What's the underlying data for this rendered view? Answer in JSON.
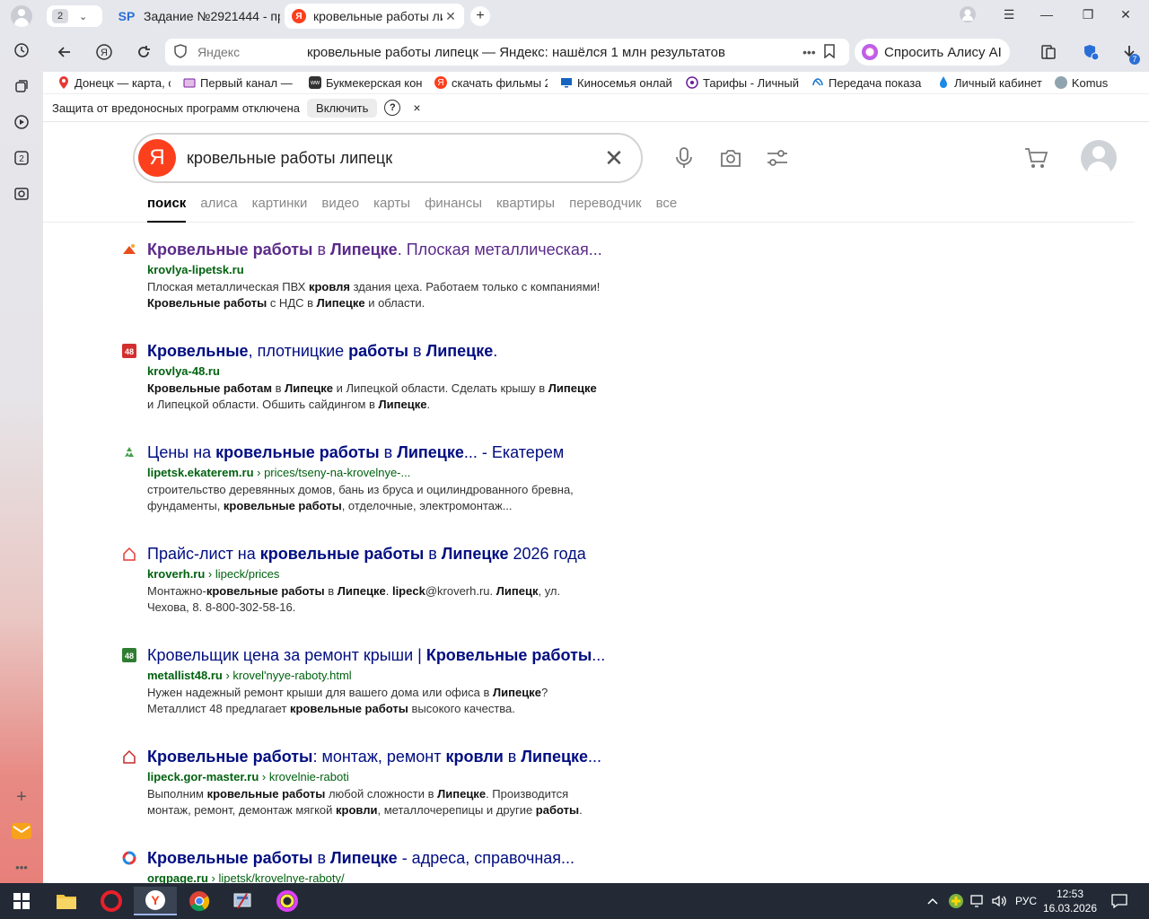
{
  "browser": {
    "tab_count": "2",
    "tabs": [
      {
        "title": "Задание №2921444 - про",
        "favicon": "SP"
      },
      {
        "title": "кровельные работы ли",
        "favicon": "Я"
      }
    ],
    "new_tab_symbol": "+",
    "address": {
      "host": "Яндекс",
      "page_title": "кровельные работы липецк — Яндекс: нашёлся 1 млн результатов"
    },
    "alice_button": "Спросить Алису AI",
    "downloads_badge": "7",
    "bookmarks": [
      {
        "label": "Донецк — карта, с",
        "icon": "map-pin-icon",
        "color": "#e53935"
      },
      {
        "label": "Первый канал — с",
        "icon": "tv-icon",
        "color": "#7b1fa2"
      },
      {
        "label": "Букмекерская кон",
        "icon": "betting-icon",
        "color": "#333333"
      },
      {
        "label": "скачать фильмы 2",
        "icon": "yandex-icon",
        "color": "#fc3f1d"
      },
      {
        "label": "Киносемья онлай",
        "icon": "monitor-icon",
        "color": "#1565c0"
      },
      {
        "label": "Тарифы - Личный",
        "icon": "phone-icon",
        "color": "#6a1b9a"
      },
      {
        "label": "Передача показа",
        "icon": "meter-icon",
        "color": "#1976d2"
      },
      {
        "label": "Личный кабинет",
        "icon": "drop-icon",
        "color": "#1e88e5"
      },
      {
        "label": "Komus",
        "icon": "store-icon",
        "color": "#546e7a"
      }
    ],
    "infobar": {
      "message": "Защита от вредоносных программ отключена",
      "button": "Включить",
      "help": "?",
      "close": "×"
    }
  },
  "search": {
    "logo": "Я",
    "query": "кровельные работы липецк",
    "tabs": [
      "поиск",
      "алиса",
      "картинки",
      "видео",
      "карты",
      "финансы",
      "квартиры",
      "переводчик",
      "все"
    ],
    "active_tab": "поиск"
  },
  "results": [
    {
      "title_html": "<b>Кровельные работы</b> в <b>Липецке</b>. Плоская металлическая...",
      "visited": true,
      "favicon": "roof-icon",
      "favicon_color": "#e84e1b",
      "domain": "krovlya-lipetsk.ru",
      "path": "",
      "snippet_html": "Плоская металлическая ПВХ <b>кровля</b> здания цеха. Работаем только с компаниями!<br><b>Кровельные работы</b> с НДС в <b>Липецке</b> и области."
    },
    {
      "title_html": "<b>Кровельные</b>, плотницкие <b>работы</b> в <b>Липецке</b>.",
      "visited": false,
      "favicon": "48-icon",
      "favicon_color": "#d32f2f",
      "domain": "krovlya-48.ru",
      "path": "",
      "snippet_html": "<b>Кровельные работам</b> в <b>Липецке</b> и Липецкой области. Сделать крышу в <b>Липецке</b><br>и Липецкой области. Обшить сайдингом в <b>Липецке</b>."
    },
    {
      "title_html": "Цены на <b>кровельные работы</b> в <b>Липецке</b>... - Екатерем",
      "visited": false,
      "favicon": "recycle-icon",
      "favicon_color": "#43a047",
      "domain": "lipetsk.ekaterem.ru",
      "path": "› prices/tseny-na-krovelnye-...",
      "snippet_html": "строительство деревянных домов, бань из бруса и оцилиндрованного бревна,<br>фундаменты, <b>кровельные работы</b>, отделочные, электромонтаж..."
    },
    {
      "title_html": "Прайс-лист на <b>кровельные работы</b> в <b>Липецке</b> 2026 года",
      "visited": false,
      "favicon": "house-icon",
      "favicon_color": "#e53935",
      "domain": "kroverh.ru",
      "path": "› lipeck/prices",
      "snippet_html": "Монтажно-<b>кровельные работы</b> в <b>Липецке</b>. <b>lipeck</b>@kroverh.ru. <b>Липецк</b>, ул.<br>Чехова, 8. 8-800-302-58-16."
    },
    {
      "title_html": "Кровельщик цена за ремонт крыши | <b>Кровельные работы</b>...",
      "visited": false,
      "favicon": "48-icon",
      "favicon_color": "#2e7d32",
      "domain": "metallist48.ru",
      "path": "› krovel'nyye-raboty.html",
      "snippet_html": "Нужен надежный ремонт крыши для вашего дома или офиса в <b>Липецке</b>?<br>Металлист 48 предлагает <b>кровельные работы</b> высокого качества."
    },
    {
      "title_html": "<b>Кровельные работы</b>: монтаж, ремонт <b>кровли</b> в <b>Липецке</b>...",
      "visited": false,
      "favicon": "house-icon",
      "favicon_color": "#c62828",
      "domain": "lipeck.gor-master.ru",
      "path": "› krovelnie-raboti",
      "snippet_html": "Выполним <b>кровельные работы</b> любой сложности в <b>Липецке</b>. Производится<br>монтаж, ремонт, демонтаж мягкой <b>кровли</b>, металлочерепицы и другие <b>работы</b>."
    },
    {
      "title_html": "<b>Кровельные работы</b> в <b>Липецке</b> - адреса, справочная...",
      "visited": false,
      "favicon": "ring-icon",
      "favicon_color": "#1e88e5",
      "domain": "orgpage.ru",
      "path": "› lipetsk/krovelnye-raboty/",
      "snippet_html": ""
    }
  ],
  "taskbar": {
    "language": "РУС",
    "time": "12:53",
    "date": "16.03.2026"
  }
}
